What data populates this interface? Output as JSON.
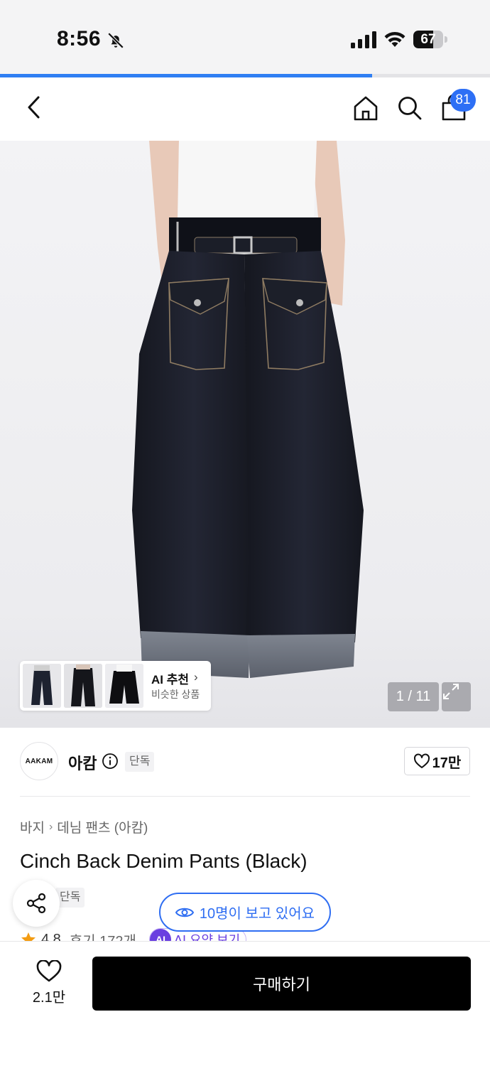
{
  "status_bar": {
    "time": "8:56",
    "battery": "67",
    "battery_level": 0.67,
    "icons": [
      "bell-off-icon",
      "signal-icon",
      "wifi-icon",
      "battery-icon"
    ]
  },
  "scroll_progress": 0.76,
  "header": {
    "cart_count": "81",
    "icons": [
      "back-chevron-icon",
      "home-icon",
      "search-icon",
      "shopping-bag-icon"
    ]
  },
  "gallery": {
    "counter": "1 / 11",
    "ai_recommend": {
      "title": "AI 추천",
      "subtitle": "비슷한 상품"
    }
  },
  "brand": {
    "logo_text": "AAKAM",
    "name": "아캄",
    "tag": "단독",
    "likes": "17만"
  },
  "breadcrumb": [
    "바지",
    "데님 팬츠 (아캄)"
  ],
  "product": {
    "title": "Cinch Back Denim Pants (Black)",
    "tag": "단독",
    "viewers": "10명이 보고 있어요",
    "rating": "4.8",
    "reviews": "후기 172개",
    "ai_badge": "AI",
    "ai_summary": "AI 요약 보기"
  },
  "bottom_bar": {
    "wish_count": "2.1만",
    "buy_label": "구매하기"
  },
  "colors": {
    "accent_blue": "#2f6ef2",
    "badge_blue": "#2d6ff5",
    "ai_purple": "#6a3fe0",
    "buy_button": "#000000"
  }
}
